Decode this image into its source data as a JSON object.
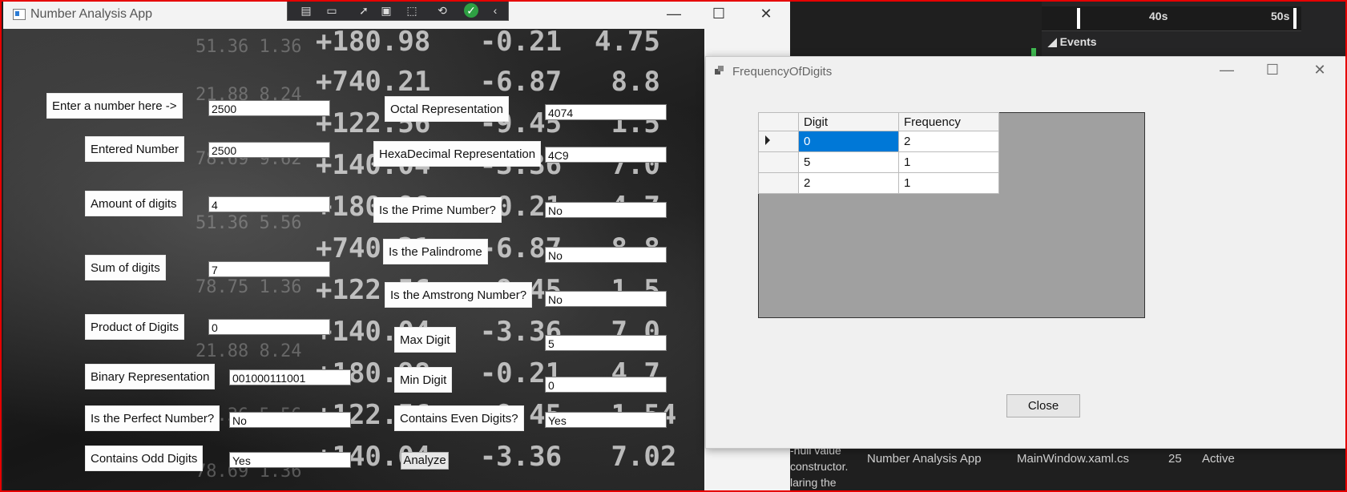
{
  "ide": {
    "timeline_labels": [
      "40s",
      "50s"
    ],
    "events_label": "Events",
    "error_lines": [
      "-null value",
      "constructor.",
      "laring the"
    ],
    "error_row": {
      "project": "Number Analysis App",
      "file": "MainWindow.xaml.cs",
      "line": "25",
      "state": "Active"
    }
  },
  "main_window": {
    "title": "Number Analysis App",
    "fields": {
      "enter_label": "Enter a number here ->",
      "enter_value": "2500",
      "entered_label": "Entered Number",
      "entered_value": "2500",
      "amount_label": "Amount of digits",
      "amount_value": "4",
      "sum_label": "Sum of digits",
      "sum_value": "7",
      "product_label": "Product of Digits",
      "product_value": "0",
      "binary_label": "Binary Representation",
      "binary_value": "001000111001",
      "perfect_label": "Is the Perfect Number?",
      "perfect_value": "No",
      "odd_label": "Contains Odd Digits",
      "odd_value": "Yes",
      "octal_label": "Octal Representation",
      "octal_value": "4074",
      "hex_label": "HexaDecimal Representation",
      "hex_value": "4C9",
      "prime_label": "Is the Prime Number?",
      "prime_value": "No",
      "palindrome_label": "Is the Palindrome",
      "palindrome_value": "No",
      "armstrong_label": "Is the Amstrong Number?",
      "armstrong_value": "No",
      "max_label": "Max Digit",
      "max_value": "5",
      "min_label": "Min Digit",
      "min_value": "0",
      "even_label": "Contains Even Digits?",
      "even_value": "Yes",
      "analyze_label": "Analyze"
    }
  },
  "frequency_window": {
    "title": "FrequencyOfDigits",
    "columns": [
      "Digit",
      "Frequency"
    ],
    "rows": [
      {
        "digit": "0",
        "frequency": "2"
      },
      {
        "digit": "5",
        "frequency": "1"
      },
      {
        "digit": "2",
        "frequency": "1"
      }
    ],
    "close_label": "Close"
  },
  "colors": {
    "selection": "#0078d7",
    "frame": "#e60000",
    "grid_bg": "#a0a0a0"
  },
  "icons": [
    "minimize-icon",
    "maximize-icon",
    "close-icon",
    "row-pointer-icon",
    "check-icon"
  ]
}
